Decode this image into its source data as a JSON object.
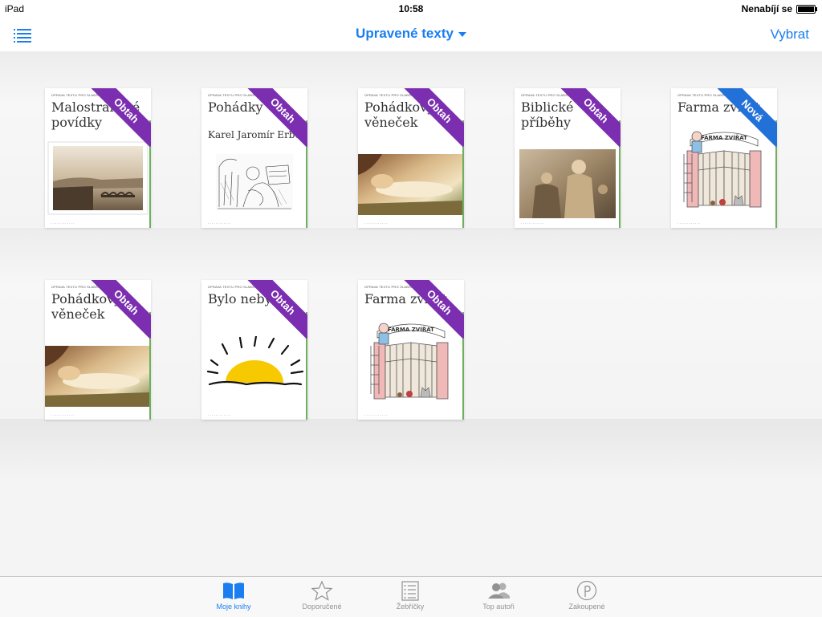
{
  "status": {
    "device": "iPad",
    "time": "10:58",
    "battery_text": "Nenabíjí se",
    "battery_level": 0.9
  },
  "nav": {
    "title": "Upravené texty",
    "right_button": "Vybrat",
    "left_icon": "list-icon"
  },
  "books": [
    {
      "header": "ÚPRAVA TEXTU PRO SLABŠÍ ČTENÁŘE",
      "title": "Malostranské povídky",
      "author": "",
      "ribbon": "Obtah",
      "ribbon_color": "#7b2fb0",
      "picture": "prague-bridge-photo"
    },
    {
      "header": "ÚPRAVA TEXTU PRO SLABŠÍ ČTENÁŘE",
      "title": "Pohádky",
      "author": "Karel Jaromír Erben",
      "ribbon": "Obtah",
      "ribbon_color": "#7b2fb0",
      "picture": "engraving-illustration"
    },
    {
      "header": "ÚPRAVA TEXTU PRO SLABŠÍ ČTENÁŘE",
      "title": "Pohádkový věneček",
      "author": "",
      "ribbon": "Obtah",
      "ribbon_color": "#7b2fb0",
      "picture": "sleeping-beauty-painting"
    },
    {
      "header": "ÚPRAVA TEXTU PRO SLABŠÍ ČTENÁŘE",
      "title": "Biblické příběhy",
      "author": "",
      "ribbon": "Obtah",
      "ribbon_color": "#7b2fb0",
      "picture": "biblical-painting"
    },
    {
      "header": "ÚPRAVA TEXTU PRO SLABŠÍ ČTENÁŘE",
      "title": "Farma zvířat",
      "author": "",
      "ribbon": "Nová",
      "ribbon_color": "#2271d8",
      "picture": "farm-gate-drawing"
    },
    {
      "header": "ÚPRAVA TEXTU PRO SLABŠÍ ČTENÁŘE",
      "title": "Pohádkový věneček",
      "author": "",
      "ribbon": "Obtah",
      "ribbon_color": "#7b2fb0",
      "picture": "sleeping-beauty-painting"
    },
    {
      "header": "ÚPRAVA TEXTU PRO SLABŠÍ ČTENÁŘE",
      "title": "Bylo nebylo",
      "author": "",
      "ribbon": "Obtah",
      "ribbon_color": "#7b2fb0",
      "picture": "sun-drawing"
    },
    {
      "header": "ÚPRAVA TEXTU PRO SLABŠÍ ČTENÁŘE",
      "title": "Farma zvířat",
      "author": "",
      "ribbon": "Obtah",
      "ribbon_color": "#7b2fb0",
      "picture": "farm-gate-drawing"
    }
  ],
  "gate_sign": "FARMA ZVÍŘAT",
  "tabs": [
    {
      "label": "Moje knihy",
      "icon": "open-book-icon",
      "active": true
    },
    {
      "label": "Doporučené",
      "icon": "star-icon",
      "active": false
    },
    {
      "label": "Žebříčky",
      "icon": "ranked-list-icon",
      "active": false
    },
    {
      "label": "Top autoři",
      "icon": "people-icon",
      "active": false
    },
    {
      "label": "Zakoupené",
      "icon": "purchased-icon",
      "active": false
    }
  ],
  "colors": {
    "accent": "#1a7ef0",
    "ribbon_purple": "#7b2fb0",
    "ribbon_blue": "#2271d8"
  }
}
